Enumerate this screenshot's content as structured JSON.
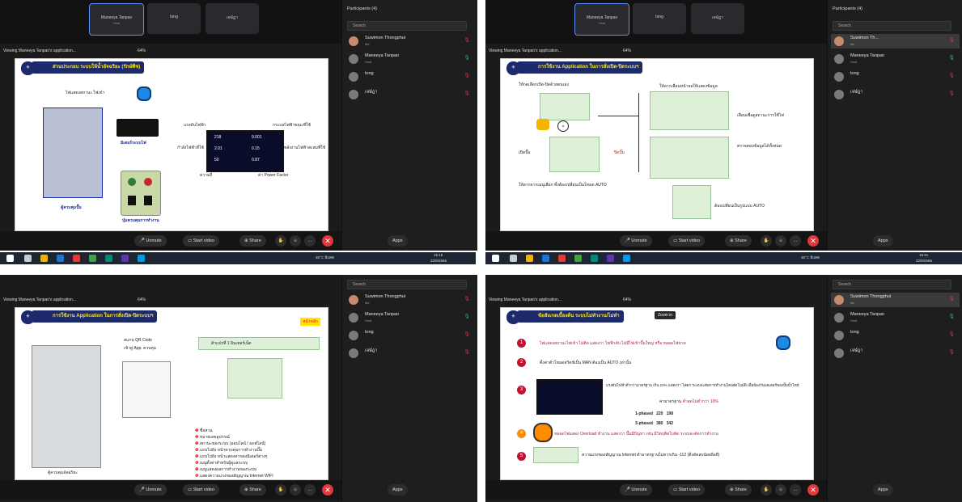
{
  "meeting": {
    "participants_header": "Participants (4)",
    "search_placeholder": "Search",
    "viewing_label": "Viewing Maneeya Tanpao's application...",
    "zoom": "64%",
    "zoom_in_tooltip": "Zoom in",
    "participants": [
      {
        "name": "Suwimon Thongphui",
        "name_short": "Suwimon Th...",
        "sub": "Me"
      },
      {
        "name": "Maneeya Tanpao",
        "sub": "Host"
      },
      {
        "name": "tong",
        "sub": ""
      },
      {
        "name": "เจษ์ฎา",
        "sub": ""
      }
    ],
    "video_tiles": [
      {
        "name": "Maneeya Tanpao",
        "sub": "Host"
      },
      {
        "name": "tong",
        "sub": ""
      },
      {
        "name": "เจษ์ฎา",
        "sub": ""
      }
    ],
    "controls": {
      "unmute": "Unmute",
      "start_video": "Start video",
      "share": "Share",
      "apps": "Apps"
    }
  },
  "taskbar": {
    "weather": "36°C มีแดด",
    "time": "15:18",
    "date": "22/6/2565",
    "time_right": "15:21"
  },
  "slides": {
    "s1": {
      "title": "ส่วนประกอบ ระบบให้น้ำอัจฉริยะ (รักษ์พืช)",
      "labels": {
        "lamp": "ไฟแสดงสถานะ ไฟเข้า",
        "meter_label": "มิเตอร์ระบบไฟ",
        "cabinet": "ตู้ควบคุมปั๊ม",
        "buttons": "ปุ่มควบคุมการทำงาน",
        "voltage": "แรงดันไฟฟ้า",
        "current": "กระแสไฟฟ้าขณะที่ใช้",
        "watt": "กำลังไฟฟ้าที่ใช้",
        "energy": "พลังงานไฟฟ้าสะสมที่ใช้",
        "freq": "ความถี่",
        "pf": "ค่า Power Factor"
      },
      "meter": {
        "v": "218",
        "v_unit": "V",
        "a": "9.001",
        "a_unit": "A",
        "kw": "2.01",
        "kw_unit": "kW",
        "kwh": "0.15",
        "kwh_unit": "kWh",
        "hz": "50",
        "hz_unit": "Hz",
        "pf": "0.87",
        "pf_unit": "PF"
      }
    },
    "s2": {
      "title": "การใช้งาน Application ในการสั่งเปิด-ปิดระบบฯ",
      "labels": {
        "select": "ให้กดเลือกเปิด-ปิดด้วยตนเอง",
        "open": "เปิดปั๊ม",
        "close": "ปิดปั๊ม",
        "after": "ให้ลากจากเมนูเลือก ทั้งต้องเปลี่ยนเป็นโหมด AUTO",
        "right1": "เลื่อนเพื่อดูสถานะการใช้ไฟ",
        "right2": "ตรวจสอบข้อมูลได้ทั้งหมด",
        "bottom": "ต้องเปลี่ยนเป็นรูปแบบ AUTO",
        "top": "ให้ลากเลื่อนหน้าจอให้แสดงข้อมูล"
      }
    },
    "s3": {
      "title": "การใช้งาน Application ในการสั่งเปิด-ปิดระบบฯ",
      "tag": "หน้าหลัก",
      "labels": {
        "qr": "สแกน QR Code",
        "qr2": "เข้าสู่ App. ควบคุม",
        "cabinet": "ตู้ควบคุมอัจฉริยะ",
        "device": "ตัวแปรที่ 1 อินเทอร์เน็ต"
      },
      "legend": [
        "ชื่อสวน",
        "หมายเลขอุปกรณ์",
        "สถานะของระบบ (ออนไลน์ / ออฟไลน์)",
        "แถบไปยัง หน้าควบคุมการทำงานปั๊ม",
        "แถบไปยัง หน้าแสดงค่าของมิเตอร์ต่างๆ",
        "เมนูตั้งค่าสำหรับผู้ดูแลระบบ",
        "เมนูแสดงผลการทำงานของระบบ",
        "แสดงความแรงของสัญญาณ Internet WIFI"
      ]
    },
    "s4": {
      "title": "ข้อสังเกตเบื้องต้น ระบบไม่ทำงาน/ไม่ทำ",
      "items": [
        "ไฟแสดงสถานะไฟเข้า ไม่ติด แสดงว่า ไฟฟ้าดับ ไม่มีไฟเข้าปั๊มใหญ่ หรือ หลอดไฟขาด",
        "ตั้งค่าตัวโหมดสวิตช์เป็น MAN ต้องเป็น AUTO เท่านั้น",
        "แรงดันไฟฟ้าต่ำกว่ามาตรฐาน เกิน 10% แสดงว่า ไฟตก ระบบจะตัดการทำงานโดยอัตโนมัติ เพื่อป้องกันมอเตอร์ของปั๊มน้ำไหม้",
        "หลอดไฟแสดง Overload ทำงาน แสดงว่า ปั๊มมีปัญหา เช่น มีวัตถุติดใบพัด ระบบจะตัดการทำงาน",
        "ความแรงของสัญญาณ Internet ต่ำมาตรฐานไม่ควรเกิน -112 (ดึงดัดลบน้อยยิ่งดี)"
      ],
      "std_label": "ค่ามาตรฐาน",
      "std_value": "ต่ำสุดไม่ต่ำกว่า 10%",
      "phases": [
        {
          "name": "1-phased",
          "min": "220",
          "low": "198"
        },
        {
          "name": "3-phased",
          "min": "380",
          "low": "342"
        }
      ]
    }
  },
  "colors": {
    "panel": "#1b1b1b",
    "slide_title_bg": "#1c2a6b",
    "slide_title_fg": "#ffe600",
    "leave": "#e0383d",
    "marker": "#c8102e"
  }
}
